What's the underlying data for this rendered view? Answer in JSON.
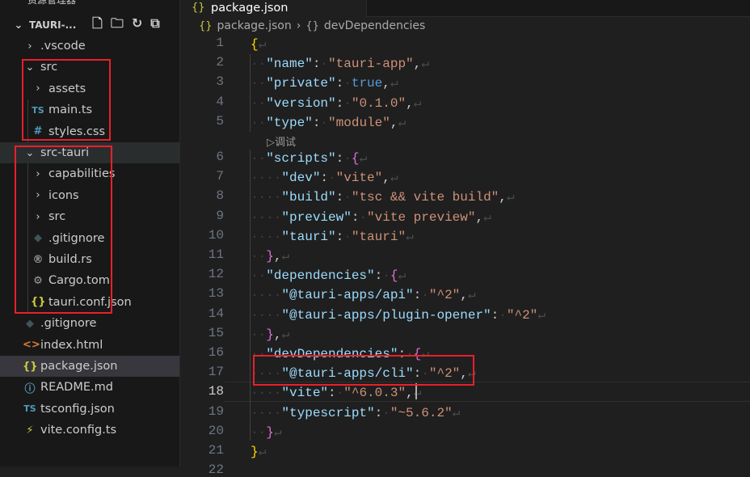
{
  "sidebar": {
    "title": "资源管理器",
    "project": "TAURI-...",
    "actions": [
      {
        "icon": "new-file-icon",
        "glyph": "🗋"
      },
      {
        "icon": "new-folder-icon",
        "glyph": "🗀"
      },
      {
        "icon": "refresh-icon",
        "glyph": "↻"
      },
      {
        "icon": "collapse-all-icon",
        "glyph": "⧉"
      }
    ],
    "items": [
      {
        "label": ".vscode",
        "kind": "folder",
        "open": false,
        "depth": 0
      },
      {
        "label": "src",
        "kind": "folder",
        "open": true,
        "depth": 0
      },
      {
        "label": "assets",
        "kind": "folder",
        "open": false,
        "depth": 1
      },
      {
        "label": "main.ts",
        "kind": "file",
        "icon": "typescript-icon",
        "glyph": "TS",
        "color": "#519aba",
        "depth": 1
      },
      {
        "label": "styles.css",
        "kind": "file",
        "icon": "css-icon",
        "glyph": "#",
        "color": "#519aba",
        "depth": 1
      },
      {
        "label": "src-tauri",
        "kind": "folder",
        "open": true,
        "depth": 0,
        "state": "hover"
      },
      {
        "label": "capabilities",
        "kind": "folder",
        "open": false,
        "depth": 1
      },
      {
        "label": "icons",
        "kind": "folder",
        "open": false,
        "depth": 1
      },
      {
        "label": "src",
        "kind": "folder",
        "open": false,
        "depth": 1
      },
      {
        "label": ".gitignore",
        "kind": "file",
        "icon": "git-icon",
        "glyph": "◆",
        "color": "#41535b",
        "depth": 1
      },
      {
        "label": "build.rs",
        "kind": "file",
        "icon": "rust-icon",
        "glyph": "®",
        "color": "#a0a0a0",
        "depth": 1
      },
      {
        "label": "Cargo.toml",
        "kind": "file",
        "icon": "gear-icon",
        "glyph": "⚙",
        "color": "#a0a0a0",
        "depth": 1
      },
      {
        "label": "tauri.conf.json",
        "kind": "file",
        "icon": "json-icon",
        "glyph": "{}",
        "color": "#cbcb41",
        "depth": 1
      },
      {
        "label": ".gitignore",
        "kind": "file",
        "icon": "git-icon",
        "glyph": "◆",
        "color": "#41535b",
        "depth": 0
      },
      {
        "label": "index.html",
        "kind": "file",
        "icon": "html-icon",
        "glyph": "<>",
        "color": "#e37933",
        "depth": 0
      },
      {
        "label": "package.json",
        "kind": "file",
        "icon": "json-icon",
        "glyph": "{}",
        "color": "#cbcb41",
        "depth": 0,
        "state": "selected"
      },
      {
        "label": "README.md",
        "kind": "file",
        "icon": "info-icon",
        "glyph": "ⓘ",
        "color": "#519aba",
        "depth": 0
      },
      {
        "label": "tsconfig.json",
        "kind": "file",
        "icon": "tsconfig-icon",
        "glyph": "TS",
        "color": "#519aba",
        "depth": 0
      },
      {
        "label": "vite.config.ts",
        "kind": "file",
        "icon": "vite-icon",
        "glyph": "⚡",
        "color": "#cbcb41",
        "depth": 0
      }
    ]
  },
  "tab": {
    "label": "package.json",
    "icon": "json-icon"
  },
  "breadcrumb": {
    "file": "package.json",
    "symbol": "devDependencies"
  },
  "codelens": "▷调试",
  "editor": {
    "current_line": 18,
    "lines": [
      {
        "n": "1",
        "t": [
          [
            "b1",
            "{"
          ]
        ]
      },
      {
        "n": "2",
        "t": [
          [
            "ws",
            "  "
          ],
          [
            "key",
            "\"name\""
          ],
          [
            "p",
            ":"
          ],
          [
            "ws",
            " "
          ],
          [
            "str",
            "\"tauri-app\""
          ],
          [
            "p",
            ","
          ]
        ]
      },
      {
        "n": "3",
        "t": [
          [
            "ws",
            "  "
          ],
          [
            "key",
            "\"private\""
          ],
          [
            "p",
            ":"
          ],
          [
            "ws",
            " "
          ],
          [
            "bool",
            "true"
          ],
          [
            "p",
            ","
          ]
        ]
      },
      {
        "n": "4",
        "t": [
          [
            "ws",
            "  "
          ],
          [
            "key",
            "\"version\""
          ],
          [
            "p",
            ":"
          ],
          [
            "ws",
            " "
          ],
          [
            "str",
            "\"0.1.0\""
          ],
          [
            "p",
            ","
          ]
        ]
      },
      {
        "n": "5",
        "t": [
          [
            "ws",
            "  "
          ],
          [
            "key",
            "\"type\""
          ],
          [
            "p",
            ":"
          ],
          [
            "ws",
            " "
          ],
          [
            "str",
            "\"module\""
          ],
          [
            "p",
            ","
          ]
        ]
      },
      {
        "n": "6",
        "t": [
          [
            "ws",
            "  "
          ],
          [
            "key",
            "\"scripts\""
          ],
          [
            "p",
            ":"
          ],
          [
            "ws",
            " "
          ],
          [
            "b2",
            "{"
          ]
        ]
      },
      {
        "n": "7",
        "t": [
          [
            "ws",
            "    "
          ],
          [
            "key",
            "\"dev\""
          ],
          [
            "p",
            ":"
          ],
          [
            "ws",
            " "
          ],
          [
            "str",
            "\"vite\""
          ],
          [
            "p",
            ","
          ]
        ]
      },
      {
        "n": "8",
        "t": [
          [
            "ws",
            "    "
          ],
          [
            "key",
            "\"build\""
          ],
          [
            "p",
            ":"
          ],
          [
            "ws",
            " "
          ],
          [
            "str",
            "\"tsc && vite build\""
          ],
          [
            "p",
            ","
          ]
        ]
      },
      {
        "n": "9",
        "t": [
          [
            "ws",
            "    "
          ],
          [
            "key",
            "\"preview\""
          ],
          [
            "p",
            ":"
          ],
          [
            "ws",
            " "
          ],
          [
            "str",
            "\"vite preview\""
          ],
          [
            "p",
            ","
          ]
        ]
      },
      {
        "n": "10",
        "t": [
          [
            "ws",
            "    "
          ],
          [
            "key",
            "\"tauri\""
          ],
          [
            "p",
            ":"
          ],
          [
            "ws",
            " "
          ],
          [
            "str",
            "\"tauri\""
          ]
        ]
      },
      {
        "n": "11",
        "t": [
          [
            "ws",
            "  "
          ],
          [
            "b2",
            "}"
          ],
          [
            "p",
            ","
          ]
        ]
      },
      {
        "n": "12",
        "t": [
          [
            "ws",
            "  "
          ],
          [
            "key",
            "\"dependencies\""
          ],
          [
            "p",
            ":"
          ],
          [
            "ws",
            " "
          ],
          [
            "b2",
            "{"
          ]
        ]
      },
      {
        "n": "13",
        "t": [
          [
            "ws",
            "    "
          ],
          [
            "key",
            "\"@tauri-apps/api\""
          ],
          [
            "p",
            ":"
          ],
          [
            "ws",
            " "
          ],
          [
            "str",
            "\"^2\""
          ],
          [
            "p",
            ","
          ]
        ]
      },
      {
        "n": "14",
        "t": [
          [
            "ws",
            "    "
          ],
          [
            "key",
            "\"@tauri-apps/plugin-opener\""
          ],
          [
            "p",
            ":"
          ],
          [
            "ws",
            " "
          ],
          [
            "str",
            "\"^2\""
          ]
        ]
      },
      {
        "n": "15",
        "t": [
          [
            "ws",
            "  "
          ],
          [
            "b2",
            "}"
          ],
          [
            "p",
            ","
          ]
        ]
      },
      {
        "n": "16",
        "t": [
          [
            "ws",
            "  "
          ],
          [
            "key",
            "\"devDependencies\""
          ],
          [
            "p",
            ":"
          ],
          [
            "ws",
            " "
          ],
          [
            "b2",
            "{"
          ]
        ]
      },
      {
        "n": "17",
        "t": [
          [
            "ws",
            "    "
          ],
          [
            "key",
            "\"@tauri-apps/cli\""
          ],
          [
            "p",
            ":"
          ],
          [
            "ws",
            " "
          ],
          [
            "str",
            "\"^2\""
          ],
          [
            "p",
            ","
          ]
        ]
      },
      {
        "n": "18",
        "t": [
          [
            "ws",
            "    "
          ],
          [
            "key",
            "\"vite\""
          ],
          [
            "p",
            ":"
          ],
          [
            "ws",
            " "
          ],
          [
            "str",
            "\"^6.0.3\""
          ],
          [
            "p",
            ","
          ]
        ]
      },
      {
        "n": "19",
        "t": [
          [
            "ws",
            "    "
          ],
          [
            "key",
            "\"typescript\""
          ],
          [
            "p",
            ":"
          ],
          [
            "ws",
            " "
          ],
          [
            "str",
            "\"~5.6.2\""
          ]
        ]
      },
      {
        "n": "20",
        "t": [
          [
            "ws",
            "  "
          ],
          [
            "b2",
            "}"
          ]
        ]
      },
      {
        "n": "21",
        "t": [
          [
            "b1",
            "}"
          ]
        ]
      },
      {
        "n": "22",
        "t": []
      }
    ]
  },
  "colors": {
    "highlight_box": "#e8202a",
    "accent_json": "#cbcb41"
  }
}
